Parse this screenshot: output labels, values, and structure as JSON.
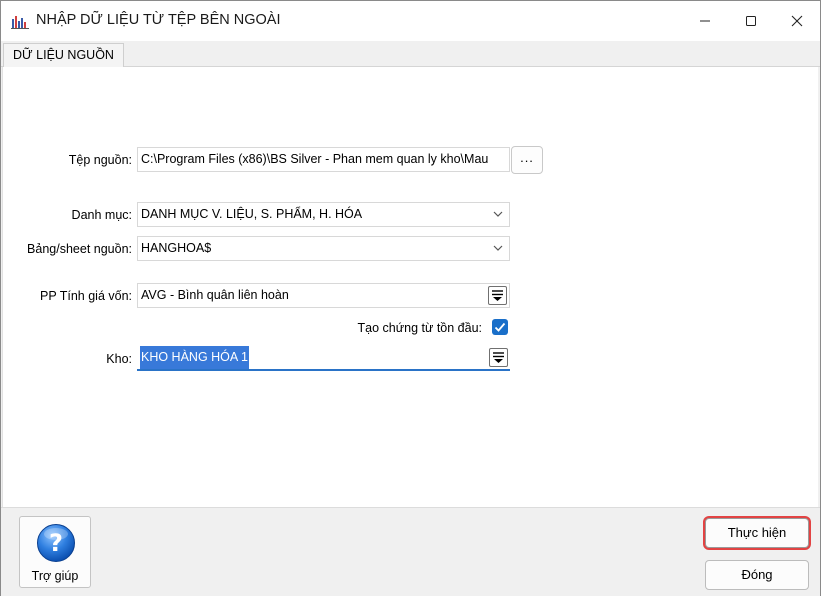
{
  "window": {
    "title": "NHẬP DỮ LIỆU TỪ TỆP BÊN NGOÀI",
    "controls": [
      "minimize-icon",
      "maximize-icon",
      "close-icon"
    ]
  },
  "tabs": [
    {
      "label": "DỮ LIỆU NGUỒN",
      "active": true
    }
  ],
  "form": {
    "source_file": {
      "label": "Tệp nguồn:",
      "value": "C:\\Program Files (x86)\\BS Silver - Phan mem quan ly kho\\Mau",
      "browse_label": "..."
    },
    "category": {
      "label": "Danh mục:",
      "value": "DANH MỤC V. LIỆU, S. PHẨM, H. HÓA"
    },
    "sheet": {
      "label": "Bảng/sheet nguồn:",
      "value": "HANGHOA$"
    },
    "costing_method": {
      "label": "PP Tính giá vốn:",
      "value": "AVG - Bình quân liên hoàn"
    },
    "opening_voucher": {
      "label": "Tạo chứng từ tồn đầu:",
      "checked": true
    },
    "warehouse": {
      "label": "Kho:",
      "value": "KHO HÀNG HÓA 1"
    }
  },
  "footer": {
    "help_label": "Trợ giúp",
    "execute_label": "Thực hiện",
    "close_label": "Đóng"
  },
  "colors": {
    "accent": "#1a6fc9",
    "selection": "#3879d9",
    "highlight_border": "#e24343"
  }
}
